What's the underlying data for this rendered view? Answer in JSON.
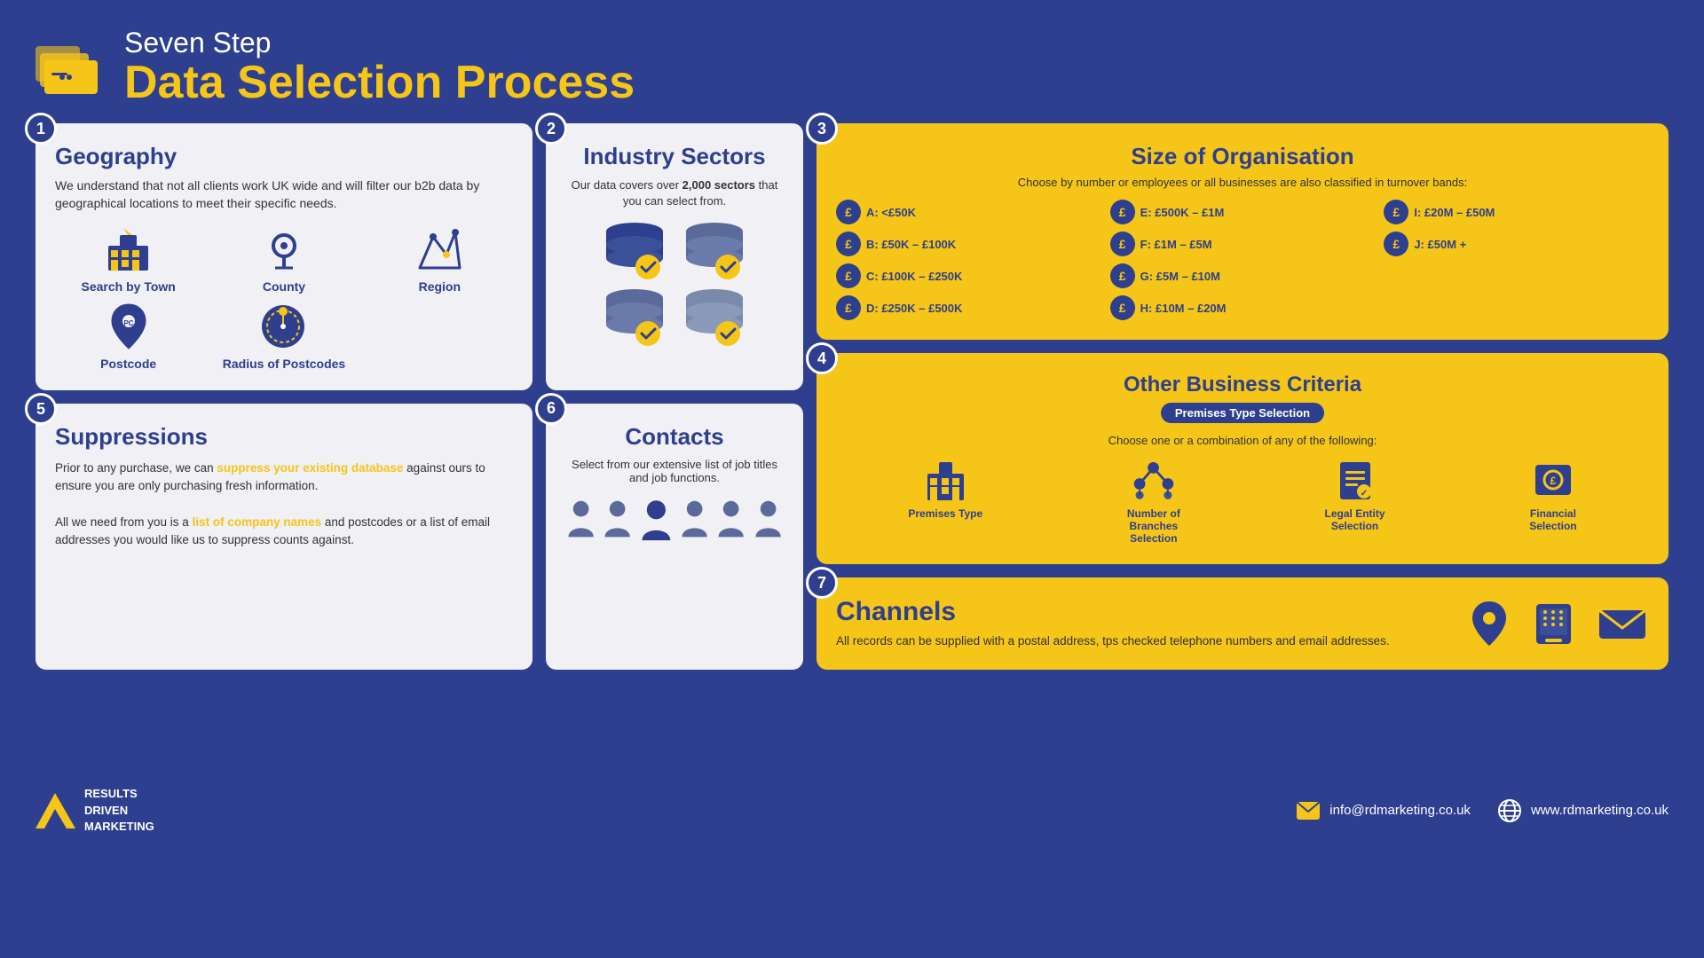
{
  "header": {
    "subtitle": "Seven Step",
    "title": "Data Selection Process"
  },
  "steps": {
    "geography": {
      "step": "1",
      "title": "Geography",
      "body": "We understand that not all clients work UK wide and will filter our b2b data by geographical locations to meet their specific needs.",
      "items": [
        {
          "label": "Search by Town",
          "icon": "building"
        },
        {
          "label": "County",
          "icon": "location"
        },
        {
          "label": "Region",
          "icon": "map"
        },
        {
          "label": "Postcode",
          "icon": "postcode"
        },
        {
          "label": "Radius of Postcodes",
          "icon": "radius"
        }
      ]
    },
    "industry": {
      "step": "2",
      "title": "Industry Sectors",
      "body": "Our data covers over 2,000 sectors that you can select from.",
      "highlight": "2,000"
    },
    "size": {
      "step": "3",
      "title": "Size of Organisation",
      "subtitle": "Choose by number or employees or all businesses are also classified in turnover bands:",
      "bands": [
        {
          "code": "A",
          "range": "A: <£50K"
        },
        {
          "code": "B",
          "range": "B: £50K – £100K"
        },
        {
          "code": "C",
          "range": "C: £100K – £250K"
        },
        {
          "code": "D",
          "range": "D: £250K – £500K"
        },
        {
          "code": "E",
          "range": "E: £500K – £1M"
        },
        {
          "code": "F",
          "range": "F: £1M – £5M"
        },
        {
          "code": "G",
          "range": "G: £5M – £10M"
        },
        {
          "code": "H",
          "range": "H: £10M – £20M"
        },
        {
          "code": "I",
          "range": "I: £20M – £50M"
        },
        {
          "code": "J",
          "range": "J: £50M +"
        }
      ]
    },
    "suppressions": {
      "step": "5",
      "title": "Suppressions",
      "body1": "Prior to any purchase, we can suppress your existing database against ours to ensure you are only purchasing fresh information.",
      "body2_pre": "All we need from you is a ",
      "body2_link": "list of company names",
      "body2_post": " and postcodes or a list of email addresses you would like us to suppress counts against.",
      "highlight1": "suppress your existing database"
    },
    "contacts": {
      "step": "6",
      "title": "Contacts",
      "body": "Select from our extensive list of job titles and job functions."
    },
    "business": {
      "step": "4",
      "title": "Other Business Criteria",
      "badge": "Premises Type Selection",
      "subtitle": "Choose one or a combination of any of the following:",
      "items": [
        {
          "label": "Premises Type",
          "icon": "building"
        },
        {
          "label": "Number of Branches Selection",
          "icon": "branches"
        },
        {
          "label": "Legal Entity Selection",
          "icon": "legal"
        },
        {
          "label": "Financial Selection",
          "icon": "financial"
        }
      ]
    },
    "channels": {
      "step": "7",
      "title": "Channels",
      "body": "All records can be supplied with a postal address, tps checked telephone numbers and email addresses."
    }
  },
  "footer": {
    "logo_line1": "RESULTS",
    "logo_line2": "DRIVEN",
    "logo_line3": "MARKETING",
    "email": "info@rdmarketing.co.uk",
    "website": "www.rdmarketing.co.uk"
  }
}
